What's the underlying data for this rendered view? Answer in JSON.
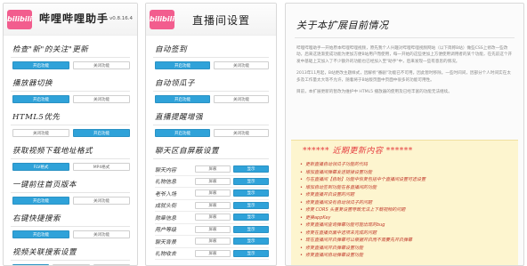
{
  "panel1": {
    "logo": "bilibili",
    "title": "哔哩哔哩助手",
    "version": "v0.8.16.4",
    "sections": [
      {
        "title": "检查\"新\"的关注\"更新",
        "buttons": [
          {
            "label": "开启功能",
            "on": true
          },
          {
            "label": "关闭功能",
            "on": false
          }
        ]
      },
      {
        "title": "播放器切换",
        "buttons": [
          {
            "label": "开启功能",
            "on": true
          },
          {
            "label": "关闭功能",
            "on": false
          }
        ]
      },
      {
        "title": "HTML5优先",
        "buttons": [
          {
            "label": "关闭功能",
            "on": false
          },
          {
            "label": "开启功能",
            "on": true
          }
        ]
      },
      {
        "title": "获取视频下载地址格式",
        "buttons": [
          {
            "label": "FLV格式",
            "on": true
          },
          {
            "label": "MP4格式",
            "on": false
          }
        ]
      },
      {
        "title": "一键前往首页版本",
        "buttons": [
          {
            "label": "开启功能",
            "on": true
          },
          {
            "label": "关闭功能",
            "on": false
          }
        ]
      },
      {
        "title": "右键快捷搜索",
        "buttons": [
          {
            "label": "开启功能",
            "on": true
          },
          {
            "label": "关闭功能",
            "on": false
          }
        ]
      },
      {
        "title": "视频关联搜索设置",
        "buttons": [
          {
            "label": "开启版（超简）",
            "on": true
          },
          {
            "label": "B站（超简）",
            "on": false
          },
          {
            "label": "关闭功能",
            "on": false
          }
        ]
      }
    ]
  },
  "panel2": {
    "logo": "bilibili",
    "title": "直播间设置",
    "sections": [
      {
        "title": "自动签到",
        "buttons": [
          {
            "label": "开启功能",
            "on": true
          },
          {
            "label": "关闭功能",
            "on": false
          }
        ]
      },
      {
        "title": "自动领瓜子",
        "buttons": [
          {
            "label": "开启功能",
            "on": true
          },
          {
            "label": "关闭功能",
            "on": false
          }
        ]
      },
      {
        "title": "直播提醒增强",
        "buttons": [
          {
            "label": "开启功能",
            "on": true
          },
          {
            "label": "关闭功能",
            "on": false
          }
        ]
      }
    ],
    "grid_title": "聊天区自屏蔽设置",
    "grid_rows": [
      {
        "label": "聊天内容",
        "a": "屏蔽",
        "b": "显示"
      },
      {
        "label": "礼物信息",
        "a": "屏蔽",
        "b": "显示"
      },
      {
        "label": "老爷入场",
        "a": "屏蔽",
        "b": "显示"
      },
      {
        "label": "成就头衔",
        "a": "屏蔽",
        "b": "显示"
      },
      {
        "label": "勋章信息",
        "a": "屏蔽",
        "b": "显示"
      },
      {
        "label": "用户等级",
        "a": "屏蔽",
        "b": "显示"
      },
      {
        "label": "聊天背景",
        "a": "屏蔽",
        "b": "显示"
      },
      {
        "label": "礼物收去",
        "a": "屏蔽",
        "b": "显示"
      }
    ]
  },
  "panel3": {
    "title": "关于本扩展目前情况",
    "paragraphs": [
      "哔哩哔哩助手一开始原本哔哩哔哩视频，原先我个人兴趣对哔哩哔哩视频网站（以下简称B站）做些CSS上修改一些改动，后来这逐渐变成功能为更加方便B站用户而使用，每一开始的这些更加上方便使用调用者的某个功能，在先前这个开发中基础上又加入了不少额外的功能也已经加入至\"助手\"中，后来发现一些有意思的情况。",
      "2013年11月起，B站更改主题样式，因解析\"番剧\"功能已不可用，因此暂时移除。一些时间间，因部分个人时间实在太多及工作量太大等不允许，随着将于B站版页面中页面中很多的功能可用性。",
      "目前，本扩展更新的暂改为维护中 HTML5 播放器的使用及已经丰富的功能无法继续。"
    ],
    "news_title": "****** 近期更新内容 ******",
    "news": [
      "更新直播自动领瓜子功能的代码",
      "增加直播间弹幕发送链接设置功能",
      "与在直播间【自助】功能中恢复包括中个直播间设置可选设置",
      "增加自动签到功能在各直播间的功能",
      "修复直播开启设置的问题",
      "修复直播间没有自动领瓜子的问题",
      "修复 CORS 头重复设置导致无法上下载视频的问题",
      "更换appKey",
      "修复直播间查询弹幕功能可能出现的bug",
      "修复在直播页面中选项未完成的问题",
      "现在直播间开启弹幕可以根据开启而不需要先开启弹幕",
      "修复直播间开启弹幕设置功能",
      "修复直播间自动弹幕设置功能"
    ]
  }
}
